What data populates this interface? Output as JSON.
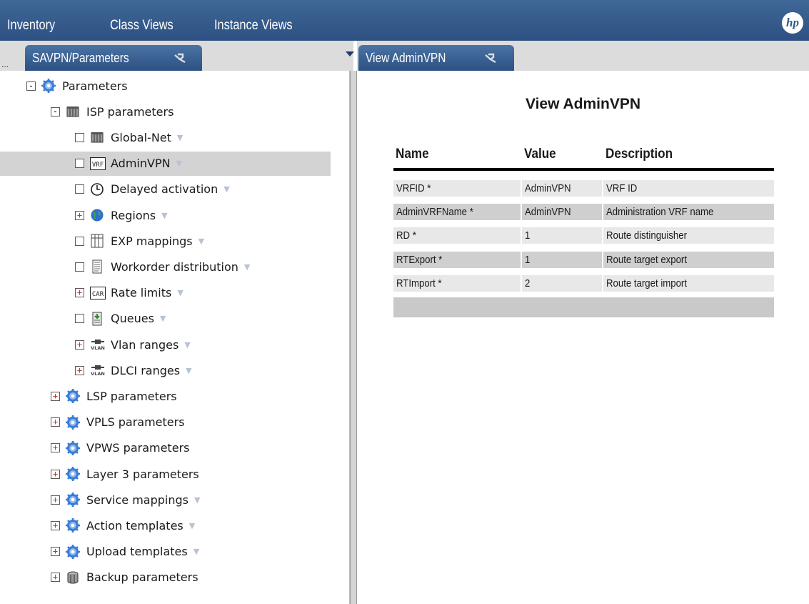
{
  "menubar": {
    "items": [
      "Inventory",
      "Class Views",
      "Instance Views"
    ],
    "logo": "hp"
  },
  "left_tab": {
    "label": "SAVPN/Parameters",
    "ellipsis": "..."
  },
  "right_tab": {
    "label": "View AdminVPN"
  },
  "tree": [
    {
      "label": "Parameters",
      "toggle": "-",
      "icon": "gear-icon",
      "dropdown": false
    },
    {
      "label": "ISP parameters",
      "toggle": "-",
      "icon": "folder-icon",
      "dropdown": false
    },
    {
      "label": "Global-Net",
      "toggle": "",
      "icon": "folder-icon",
      "dropdown": true
    },
    {
      "label": "AdminVPN",
      "toggle": "",
      "icon": "vrf-icon",
      "dropdown": true,
      "selected": true
    },
    {
      "label": "Delayed activation",
      "toggle": "",
      "icon": "clock-icon",
      "dropdown": true
    },
    {
      "label": "Regions",
      "toggle": "+",
      "icon": "globe-icon",
      "dropdown": true
    },
    {
      "label": "EXP mappings",
      "toggle": "",
      "icon": "grid-icon",
      "dropdown": true
    },
    {
      "label": "Workorder distribution",
      "toggle": "",
      "icon": "document-icon",
      "dropdown": true
    },
    {
      "label": "Rate limits",
      "toggle": "+",
      "icon": "car-icon",
      "dropdown": true
    },
    {
      "label": "Queues",
      "toggle": "",
      "icon": "queue-icon",
      "dropdown": true
    },
    {
      "label": "Vlan ranges",
      "toggle": "+",
      "icon": "vlan-icon",
      "dropdown": true
    },
    {
      "label": "DLCI ranges",
      "toggle": "+",
      "icon": "vlan-icon",
      "dropdown": true
    },
    {
      "label": "LSP parameters",
      "toggle": "+",
      "icon": "gear-icon",
      "dropdown": false
    },
    {
      "label": "VPLS parameters",
      "toggle": "+",
      "icon": "gear-icon",
      "dropdown": false
    },
    {
      "label": "VPWS parameters",
      "toggle": "+",
      "icon": "gear-icon",
      "dropdown": false
    },
    {
      "label": "Layer 3 parameters",
      "toggle": "+",
      "icon": "gear-icon",
      "dropdown": false
    },
    {
      "label": "Service mappings",
      "toggle": "+",
      "icon": "gear-icon",
      "dropdown": true
    },
    {
      "label": "Action templates",
      "toggle": "+",
      "icon": "gear-icon",
      "dropdown": true
    },
    {
      "label": "Upload templates",
      "toggle": "+",
      "icon": "gear-icon",
      "dropdown": true
    },
    {
      "label": "Backup parameters",
      "toggle": "+",
      "icon": "database-icon",
      "dropdown": false
    }
  ],
  "view": {
    "title": "View AdminVPN",
    "columns": [
      "Name",
      "Value",
      "Description"
    ],
    "rows": [
      {
        "name": "VRFID *",
        "value": "AdminVPN",
        "description": "VRF ID"
      },
      {
        "name": "AdminVRFName *",
        "value": "AdminVPN",
        "description": "Administration VRF name"
      },
      {
        "name": "RD *",
        "value": "1",
        "description": "Route distinguisher"
      },
      {
        "name": "RTExport *",
        "value": "1",
        "description": "Route target export"
      },
      {
        "name": "RTImport *",
        "value": "2",
        "description": "Route target import"
      }
    ]
  },
  "colors": {
    "menubar": "#33598a",
    "tab": "#3b6393",
    "selected_row": "#d3d3d3",
    "gear": "#3a7bd5"
  }
}
